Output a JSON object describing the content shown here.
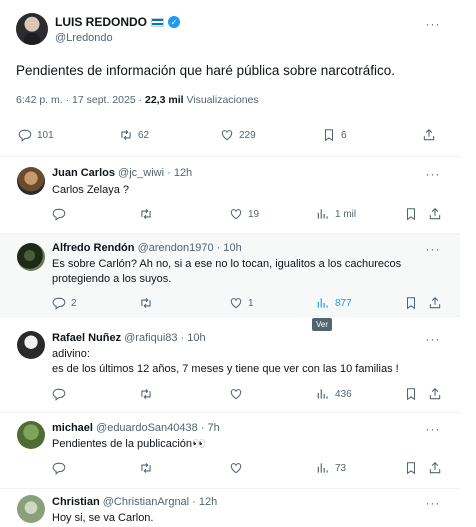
{
  "main_tweet": {
    "author_name": "LUIS REDONDO",
    "handle": "@Lredondo",
    "text": "Pendientes de información que haré pública sobre narcotráfico.",
    "time": "6:42 p. m. · 17 sept. 2025 · ",
    "views_count": "22,3 mil",
    "views_label": " Visualizaciones",
    "replies": "101",
    "reposts": "62",
    "likes": "229",
    "bookmarks": "6",
    "more": "···",
    "flag_colors": [
      "#0073cf",
      "#ffffff",
      "#0073cf"
    ]
  },
  "replies": [
    {
      "name": "Juan Carlos",
      "handle": "@jc_wiwi",
      "time": " · 12h",
      "text": "Carlos Zelaya ?",
      "replies": "",
      "reposts": "",
      "likes": "19",
      "views": "1 mil"
    },
    {
      "name": "Alfredo Rendón",
      "handle": "@arendon1970",
      "time": " · 10h",
      "text": "Es sobre Carlón? Ah no, si a ese no lo tocan, igualitos a los cachurecos protegiendo a los suyos.",
      "replies": "2",
      "reposts": "",
      "likes": "1",
      "views": "877"
    },
    {
      "name": "Rafael Nuñez",
      "handle": "@rafiqui83",
      "time": " · 10h",
      "text": "adivino:\nes de los últimos 12 años, 7 meses y tiene que ver con las 10 familias !",
      "replies": "",
      "reposts": "",
      "likes": "",
      "views": "436"
    },
    {
      "name": "michael",
      "handle": "@eduardoSan40438",
      "time": " · 7h",
      "text": "Pendientes de la publicación👀",
      "replies": "",
      "reposts": "",
      "likes": "",
      "views": "73"
    },
    {
      "name": "Christian",
      "handle": "@ChristianArgnal",
      "time": " · 12h",
      "text": "Hoy si, se va Carlon."
    }
  ],
  "tooltip": "Ver",
  "colors": {
    "accent": "#1d9bf0",
    "text": "#0f1419",
    "muted": "#536471",
    "hover_bg": "#f7f9f9"
  },
  "icons": [
    "reply-icon",
    "repost-icon",
    "like-icon",
    "views-icon",
    "bookmark-icon",
    "share-icon",
    "verified-icon",
    "more-icon"
  ]
}
